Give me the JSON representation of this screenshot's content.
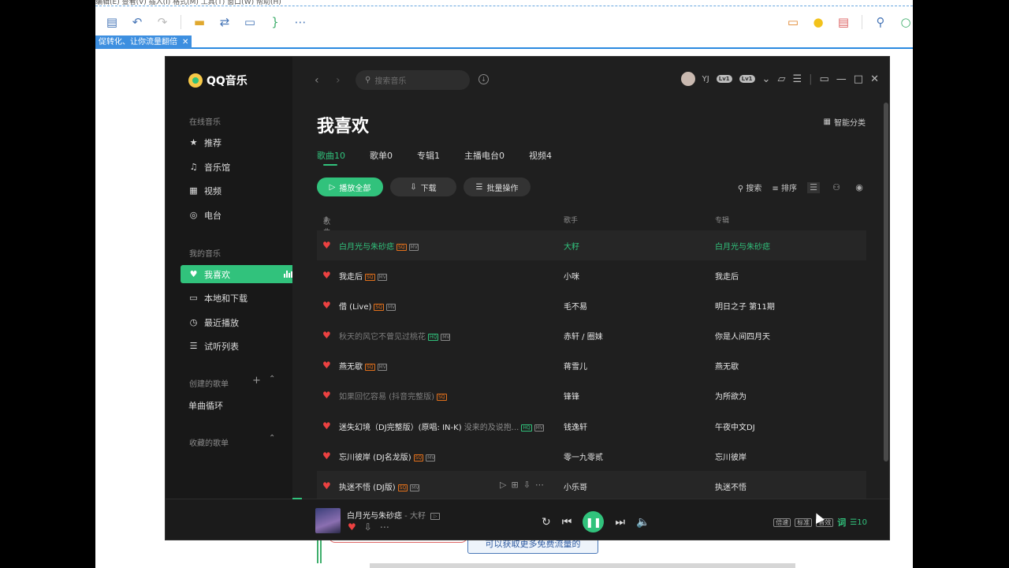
{
  "bg_app": {
    "menubar": "编辑(E)   查看(V)   插入(I)   格式(M)   工具(T)   窗口(W)   帮助(H)",
    "tab_label": "促转化、让你流量翻倍",
    "tab_close": "✕",
    "bottom_button": "可以获取更多免费流量的"
  },
  "app": {
    "logo": "QQ音乐",
    "search_placeholder": "搜索音乐",
    "user_name": "YJ",
    "badges": [
      "Lv1",
      "Lv1"
    ]
  },
  "sidebar": {
    "online_label": "在线音乐",
    "online_items": [
      {
        "label": "推荐",
        "icon": "star-icon"
      },
      {
        "label": "音乐馆",
        "icon": "music-note-icon"
      },
      {
        "label": "视频",
        "icon": "video-icon"
      },
      {
        "label": "电台",
        "icon": "radio-icon"
      }
    ],
    "my_label": "我的音乐",
    "my_items": [
      {
        "label": "我喜欢",
        "icon": "heart-icon"
      },
      {
        "label": "本地和下载",
        "icon": "monitor-icon"
      },
      {
        "label": "最近播放",
        "icon": "clock-icon"
      },
      {
        "label": "试听列表",
        "icon": "list-icon"
      }
    ],
    "created_label": "创建的歌单",
    "created_items": [
      "单曲循环"
    ],
    "collected_label": "收藏的歌单"
  },
  "header": {
    "title": "我喜欢",
    "smart_category": "智能分类",
    "tabs": [
      "歌曲10",
      "歌单0",
      "专辑1",
      "主播电台0",
      "视频4"
    ],
    "play_all": "播放全部",
    "download": "下载",
    "batch": "批量操作",
    "search": "搜索",
    "sort": "排序"
  },
  "table": {
    "columns": [
      "歌曲",
      "歌手",
      "专辑"
    ],
    "rows": [
      {
        "title": "白月光与朱砂痣",
        "sub": "",
        "tags": [
          "SQ",
          "MV"
        ],
        "artist": "大籽",
        "album": "白月光与朱砂痣",
        "state": "playing"
      },
      {
        "title": "我走后",
        "sub": "",
        "tags": [
          "SQ",
          "MV"
        ],
        "artist": "小咪",
        "album": "我走后",
        "state": "normal"
      },
      {
        "title": "借 (Live)",
        "sub": "",
        "tags": [
          "SQ",
          "MV"
        ],
        "artist": "毛不易",
        "album": "明日之子 第11期",
        "state": "normal"
      },
      {
        "title": "秋天的风它不曾见过桃花",
        "sub": "",
        "tags": [
          "HQ",
          "MV"
        ],
        "artist": "赤轩 / 圈妹",
        "album": "你是人间四月天",
        "state": "dim"
      },
      {
        "title": "燕无歇",
        "sub": "",
        "tags": [
          "SQ",
          "MV"
        ],
        "artist": "蒋雪儿",
        "album": "燕无歇",
        "state": "normal"
      },
      {
        "title": "如果回忆容易 (抖音完整版)",
        "sub": "",
        "tags": [
          "SQ"
        ],
        "artist": "锋锋",
        "album": "为所欲为",
        "state": "dim"
      },
      {
        "title": "迷失幻境（DJ完整版）(原唱: IN-K)",
        "sub": " 没来的及说抱...",
        "tags": [
          "HQ",
          "MV"
        ],
        "artist": "钱逸轩",
        "album": "午夜中文DJ",
        "state": "normal"
      },
      {
        "title": "忘川彼岸 (DJ名龙版)",
        "sub": "",
        "tags": [
          "SQ",
          "MV"
        ],
        "artist": "零一九零贰",
        "album": "忘川彼岸",
        "state": "normal"
      },
      {
        "title": "执迷不悟 (DJ版)",
        "sub": "",
        "tags": [
          "SQ",
          "MV"
        ],
        "artist": "小乐哥",
        "album": "执迷不悟",
        "state": "hover"
      }
    ]
  },
  "player": {
    "title": "白月光与朱砂痣",
    "artist_sep": " - 大籽",
    "speed": "倍速",
    "quality": "标准",
    "effect": "音效",
    "lyric": "词",
    "count": "10"
  },
  "colors": {
    "accent": "#31c27c",
    "heart": "#ec4141",
    "sq": "#e4711b"
  }
}
